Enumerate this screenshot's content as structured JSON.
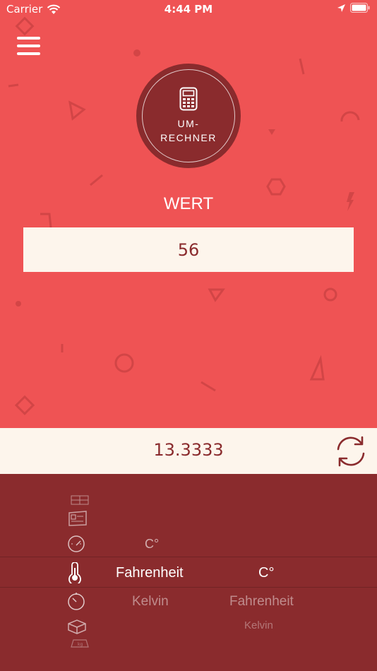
{
  "status": {
    "carrier": "Carrier",
    "time": "4:44 PM"
  },
  "logo": {
    "line1": "UM-",
    "line2": "RECHNER"
  },
  "input": {
    "label": "WERT",
    "value": "56"
  },
  "result": {
    "value": "13.3333"
  },
  "picker": {
    "categories": [
      "ruler-icon",
      "area-icon",
      "speed-icon",
      "temperature-icon",
      "time-icon",
      "volume-icon",
      "weight-icon"
    ],
    "from_units": {
      "above": "C°",
      "selected": "Fahrenheit",
      "below": "Kelvin"
    },
    "to_units": {
      "selected": "C°",
      "below1": "Fahrenheit",
      "below2": "Kelvin"
    }
  },
  "colors": {
    "background": "#ef5354",
    "dark": "#8a2b2d",
    "light": "#fdf5ec"
  }
}
